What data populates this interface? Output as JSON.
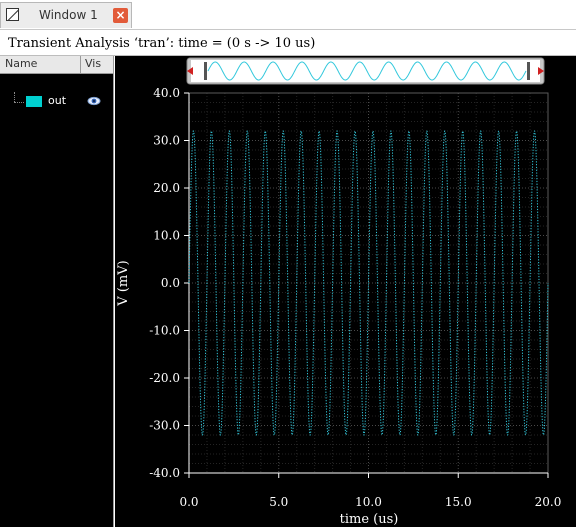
{
  "window": {
    "tab_label": "Window 1",
    "close_glyph": "×"
  },
  "title": "Transient Analysis ‘tran’: time = (0 s -> 10 us)",
  "sidebar": {
    "col_name": "Name",
    "col_vis": "Vis",
    "signals": [
      {
        "label": "out",
        "color": "#00d0d0",
        "visible_icon": "eye-icon"
      }
    ]
  },
  "colors": {
    "trace": "#33c8dc",
    "background": "#000000",
    "grid": "#3a3a3a",
    "text": "#ffffff"
  },
  "chart_data": {
    "type": "line",
    "xlabel": "time (us)",
    "ylabel": "V (mV)",
    "xlim": [
      0,
      20
    ],
    "ylim": [
      -40,
      40
    ],
    "x_ticks": [
      "0.0",
      "5.0",
      "10.0",
      "15.0",
      "20.0"
    ],
    "y_ticks": [
      "40.0",
      "30.0",
      "20.0",
      "10.0",
      "0.0",
      "-10.0",
      "-20.0",
      "-30.0",
      "-40.0"
    ],
    "grid": true,
    "series": [
      {
        "name": "out",
        "color": "#33c8dc",
        "waveform": "sine",
        "amplitude": 32,
        "frequency_mhz": 1.0,
        "offset": 0,
        "phase_deg": 0
      }
    ]
  }
}
